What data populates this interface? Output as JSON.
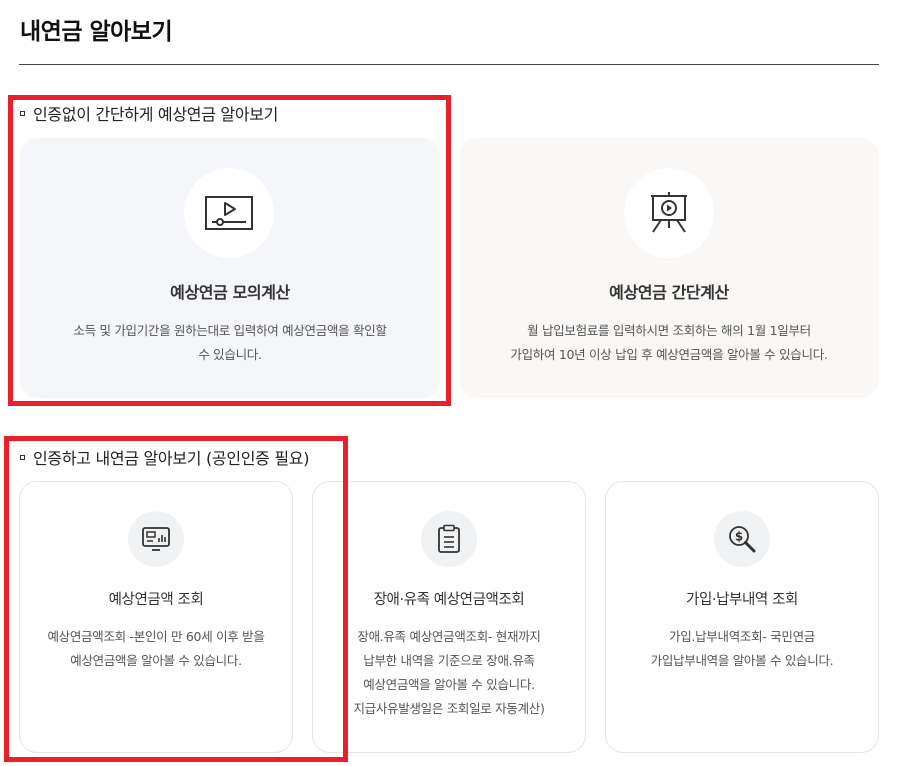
{
  "page": {
    "title": "내연금 알아보기"
  },
  "section1": {
    "label": "인증없이 간단하게 예상연금 알아보기",
    "cards": [
      {
        "title": "예상연금 모의계산",
        "desc_line1": "소득 및 가입기간을 원하는대로 입력하여 예상연금액을 확인할",
        "desc_line2": "수 있습니다.",
        "icon": "video-player-icon"
      },
      {
        "title": "예상연금 간단계산",
        "desc_line1": "월 납입보험료를 입력하시면 조회하는 해의 1월 1일부터",
        "desc_line2": "가입하여 10년 이상 납입 후 예상연금액을 알아볼 수 있습니다.",
        "icon": "presentation-easel-icon"
      }
    ]
  },
  "section2": {
    "label": "인증하고 내연금 알아보기 (공인인증 필요)",
    "cards": [
      {
        "title": "예상연금액 조회",
        "desc": [
          "예상연금액조회 -본인이 만 60세 이후 받을",
          "예상연금액을 알아볼 수 있습니다."
        ],
        "icon": "monitor-chart-icon"
      },
      {
        "title": "장애·유족 예상연금액조회",
        "desc": [
          "장애.유족 예상연금액조회- 현재까지",
          "납부한 내역을 기준으로 장애.유족",
          "예상연금액을 알아볼 수 있습니다.",
          "지급사유발생일은 조회일로 자동계산)"
        ],
        "icon": "clipboard-icon"
      },
      {
        "title": "가입·납부내역 조회",
        "desc": [
          "가입.납부내역조회- 국민연금",
          "가입납부내역을 알아볼 수 있습니다."
        ],
        "icon": "dollar-search-icon"
      }
    ]
  },
  "colors": {
    "highlight": "#e8202a",
    "card_gray": "#f5f6f9",
    "card_beige": "#faf8f6"
  }
}
